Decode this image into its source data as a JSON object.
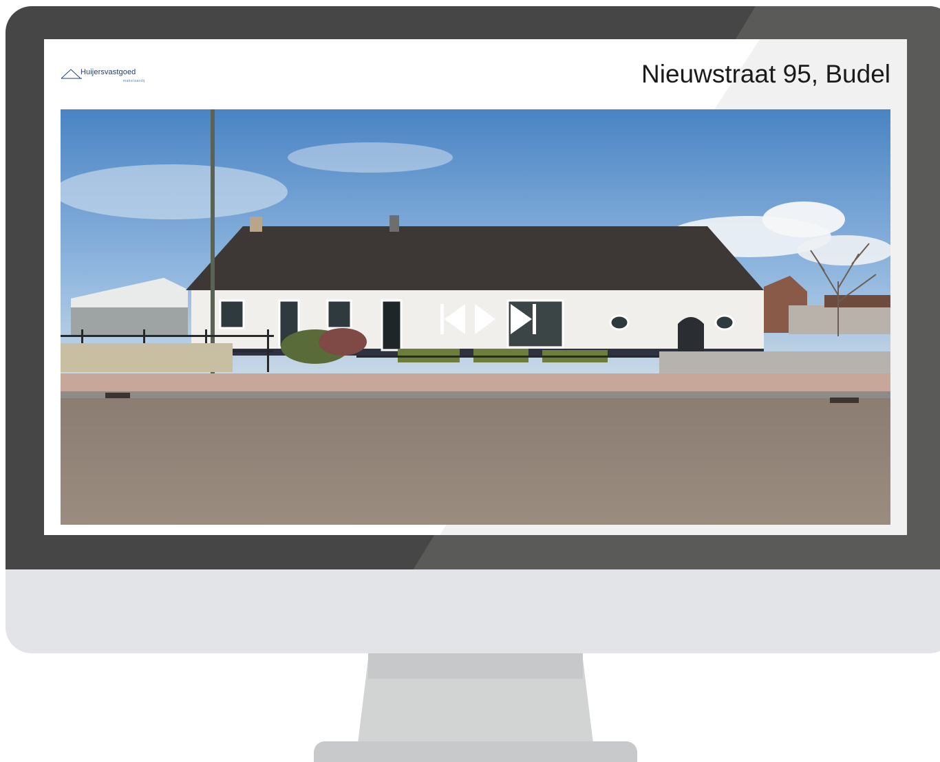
{
  "logo": {
    "brand": "Huijersvastgoed",
    "tagline": "makelaardij"
  },
  "header": {
    "title": "Nieuwstraat 95, Budel"
  },
  "slideshow": {
    "controls": [
      "previous",
      "play",
      "next"
    ],
    "icons": {
      "previous": "skip-back-icon",
      "play": "play-icon",
      "next": "skip-forward-icon"
    }
  },
  "colors": {
    "bezel": "#464646",
    "chin": "#e3e4e8",
    "brand": "#1c3d73"
  }
}
